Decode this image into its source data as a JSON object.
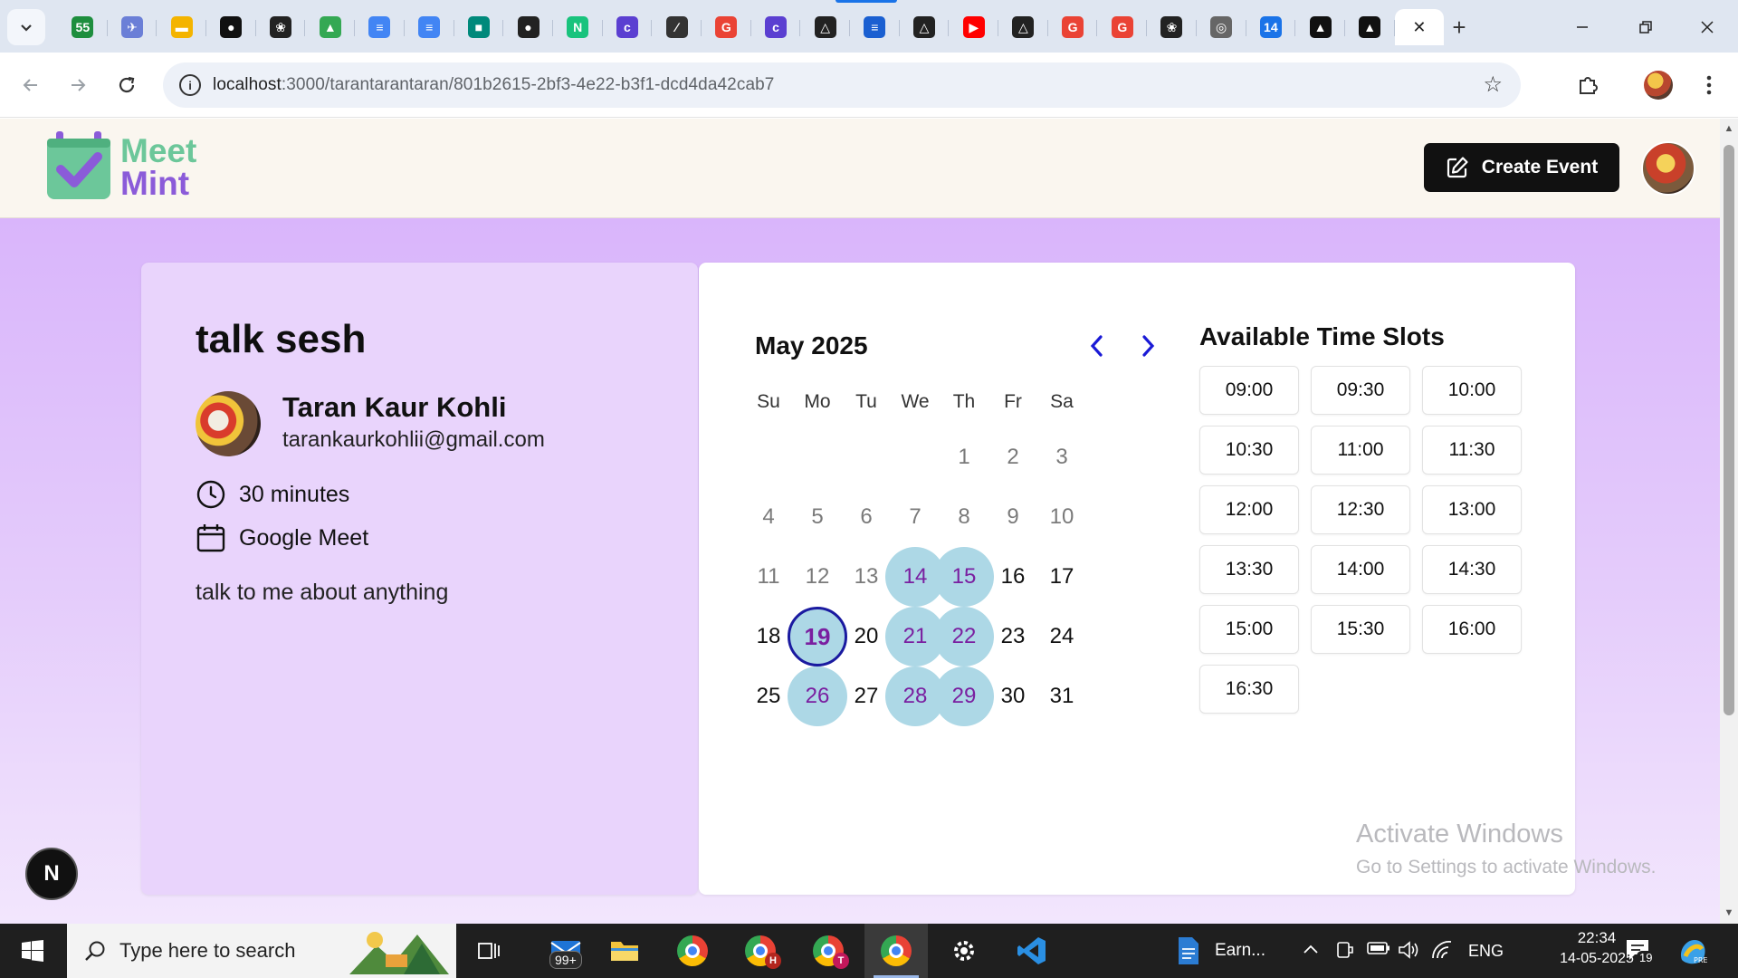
{
  "browser": {
    "tab_favicons": [
      {
        "icon": "sheets-55-icon",
        "color": "#1e8e3e",
        "glyph": "55"
      },
      {
        "icon": "bird-icon",
        "color": "#6b7fd7",
        "glyph": "✈"
      },
      {
        "icon": "slides-icon",
        "color": "#f4b400",
        "glyph": "▬"
      },
      {
        "icon": "mongodb-icon",
        "color": "#111111",
        "glyph": "●"
      },
      {
        "icon": "openai-icon",
        "color": "#222222",
        "glyph": "❀"
      },
      {
        "icon": "drive-icon",
        "color": "#34a853",
        "glyph": "▲"
      },
      {
        "icon": "docs-icon",
        "color": "#4285f4",
        "glyph": "≡"
      },
      {
        "icon": "docs-icon",
        "color": "#4285f4",
        "glyph": "≡"
      },
      {
        "icon": "meet-icon",
        "color": "#00897b",
        "glyph": "■"
      },
      {
        "icon": "github-icon",
        "color": "#222222",
        "glyph": "●"
      },
      {
        "icon": "n-app-icon",
        "color": "#19c37d",
        "glyph": "N"
      },
      {
        "icon": "c-app-icon",
        "color": "#5b3fd1",
        "glyph": "c"
      },
      {
        "icon": "pen-icon",
        "color": "#333333",
        "glyph": "∕"
      },
      {
        "icon": "google-icon",
        "color": "#ea4335",
        "glyph": "G"
      },
      {
        "icon": "c-app-icon",
        "color": "#5b3fd1",
        "glyph": "c"
      },
      {
        "icon": "triangle-logo-icon",
        "color": "#222222",
        "glyph": "△"
      },
      {
        "icon": "stripes-icon",
        "color": "#1a5fd1",
        "glyph": "≡"
      },
      {
        "icon": "triangle-logo-icon",
        "color": "#222222",
        "glyph": "△"
      },
      {
        "icon": "youtube-icon",
        "color": "#ff0000",
        "glyph": "▶"
      },
      {
        "icon": "triangle-logo-icon",
        "color": "#222222",
        "glyph": "△"
      },
      {
        "icon": "google-icon",
        "color": "#ea4335",
        "glyph": "G"
      },
      {
        "icon": "google-icon",
        "color": "#ea4335",
        "glyph": "G"
      },
      {
        "icon": "openai-icon",
        "color": "#222222",
        "glyph": "❀"
      },
      {
        "icon": "chrome-gray-icon",
        "color": "#666666",
        "glyph": "◎"
      },
      {
        "icon": "calendar-14-icon",
        "color": "#1a73e8",
        "glyph": "14"
      },
      {
        "icon": "vercel-icon",
        "color": "#111111",
        "glyph": "▲"
      },
      {
        "icon": "vercel-icon",
        "color": "#111111",
        "glyph": "▲"
      }
    ],
    "active_tab_close": "✕",
    "new_tab": "+",
    "url_host": "localhost",
    "url_rest": ":3000/tarantarantaran/801b2615-2bf3-4e22-b3f1-dcd4da42cab7"
  },
  "app": {
    "logo_line1": "Meet",
    "logo_line2": "Mint",
    "create_event_label": "Create Event"
  },
  "event": {
    "title": "talk sesh",
    "host_name": "Taran Kaur Kohli",
    "host_email": "tarankaurkohlii@gmail.com",
    "duration": "30 minutes",
    "platform": "Google Meet",
    "description": "talk to me about anything"
  },
  "calendar": {
    "month_label": "May 2025",
    "weekdays": [
      "Su",
      "Mo",
      "Tu",
      "We",
      "Th",
      "Fr",
      "Sa"
    ],
    "first_weekday_index": 4,
    "days_in_month": 31,
    "disabled_until": 13,
    "available_days": [
      14,
      15,
      21,
      22,
      26,
      28,
      29
    ],
    "selected_day": 19
  },
  "slots": {
    "title": "Available Time Slots",
    "times": [
      "09:00",
      "09:30",
      "10:00",
      "10:30",
      "11:00",
      "11:30",
      "12:00",
      "12:30",
      "13:00",
      "13:30",
      "14:00",
      "14:30",
      "15:00",
      "15:30",
      "16:00",
      "16:30"
    ]
  },
  "watermark": {
    "title": "Activate Windows",
    "subtitle": "Go to Settings to activate Windows."
  },
  "next_badge": "N",
  "taskbar": {
    "search_placeholder": "Type here to search",
    "mail_badge": "99+",
    "chrome_badges": [
      "H",
      "T"
    ],
    "word_doc_label": "Earn...",
    "language": "ENG",
    "time": "22:34",
    "date": "14-05-2025",
    "notifications": "19"
  }
}
